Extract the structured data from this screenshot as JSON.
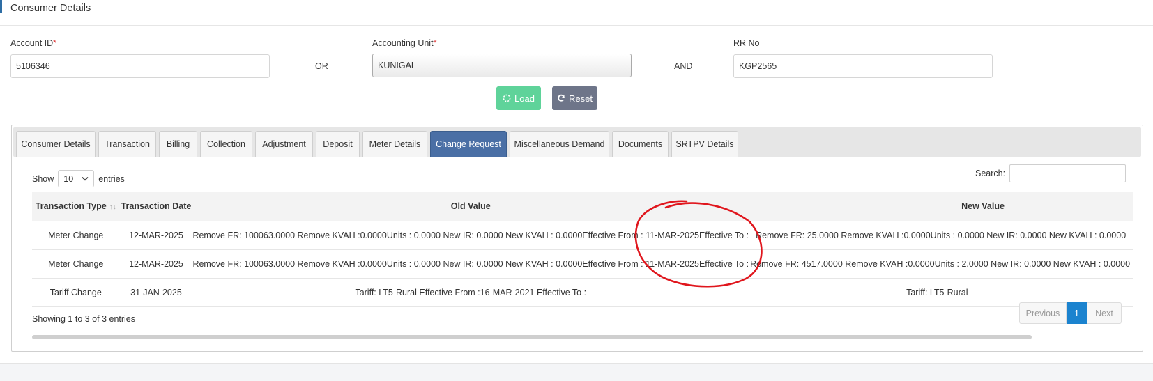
{
  "header": {
    "title": "Consumer Details"
  },
  "form": {
    "account_id": {
      "label": "Account ID",
      "required": "*",
      "value": "5106346"
    },
    "or_label": "OR",
    "accounting_unit": {
      "label": "Accounting Unit",
      "required": "*",
      "value": "KUNIGAL"
    },
    "and_label": "AND",
    "rr_no": {
      "label": "RR No",
      "value": "KGP2565"
    },
    "load_label": "Load",
    "reset_label": "Reset"
  },
  "tabs": [
    {
      "label": "Consumer Details"
    },
    {
      "label": "Transaction"
    },
    {
      "label": "Billing"
    },
    {
      "label": "Collection"
    },
    {
      "label": "Adjustment"
    },
    {
      "label": "Deposit"
    },
    {
      "label": "Meter Details"
    },
    {
      "label": "Change Request",
      "active": true
    },
    {
      "label": "Miscellaneous Demand"
    },
    {
      "label": "Documents"
    },
    {
      "label": "SRTPV Details"
    }
  ],
  "table_controls": {
    "show_label": "Show",
    "entries_value": "10",
    "entries_label": "entries",
    "search_label": "Search:"
  },
  "table": {
    "columns": [
      "Transaction Type",
      "Transaction Date",
      "Old Value",
      "New Value"
    ],
    "rows": [
      [
        "Meter Change",
        "12-MAR-2025",
        "Remove FR: 100063.0000 Remove KVAH :0.0000Units : 0.0000 New IR: 0.0000 New KVAH : 0.0000Effective From : 11-MAR-2025Effective To :",
        "Remove FR: 25.0000 Remove KVAH :0.0000Units : 0.0000 New IR: 0.0000 New KVAH : 0.0000"
      ],
      [
        "Meter Change",
        "12-MAR-2025",
        "Remove FR: 100063.0000 Remove KVAH :0.0000Units : 0.0000 New IR: 0.0000 New KVAH : 0.0000Effective From : 11-MAR-2025Effective To :",
        "Remove FR: 4517.0000 Remove KVAH :0.0000Units : 2.0000 New IR: 0.0000 New KVAH : 0.0000"
      ],
      [
        "Tariff Change",
        "31-JAN-2025",
        "Tariff: LT5-Rural Effective From :16-MAR-2021 Effective To :",
        "Tariff: LT5-Rural"
      ]
    ]
  },
  "footer": {
    "info": "Showing 1 to 3 of 3 entries",
    "prev_label": "Previous",
    "page": "1",
    "next_label": "Next"
  },
  "colors": {
    "active_tab": "#4a6fa5",
    "load": "#5fd39a",
    "reset": "#6e7589",
    "annotation": "#e0161d",
    "page_active": "#1b83cf"
  }
}
